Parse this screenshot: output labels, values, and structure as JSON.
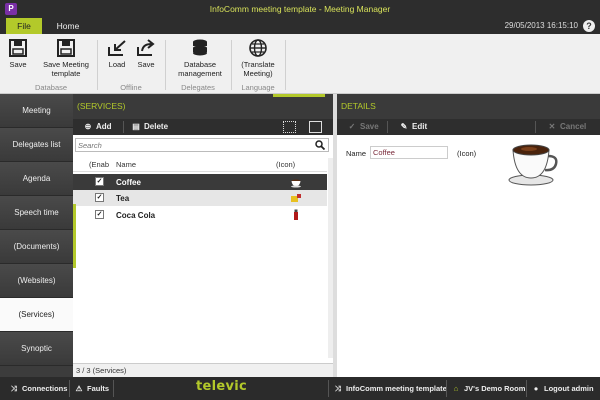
{
  "window": {
    "title": "InfoComm meeting template - Meeting Manager",
    "app_icon": "P"
  },
  "tabs": {
    "file": "File",
    "home": "Home"
  },
  "clock": "29/05/2013 16:15:10",
  "help_symbol": "?",
  "ribbon": {
    "save": "Save",
    "save_meeting_template": "Save Meeting template",
    "load": "Load",
    "save_offline": "Save",
    "database_management": "Database management",
    "translate_meeting": "(Translate Meeting)",
    "groups": {
      "database": "Database",
      "offline": "Offline",
      "delegates": "Delegates",
      "language": "Language"
    }
  },
  "nav": [
    "Meeting",
    "Delegates list",
    "Agenda",
    "Speech time",
    "(Documents)",
    "(Websites)",
    "(Services)",
    "Synoptic"
  ],
  "services": {
    "title": "(SERVICES)",
    "add_label": "Add",
    "delete_label": "Delete",
    "search_placeholder": "Search",
    "columns": {
      "enabled": "(Enab",
      "name": "Name",
      "icon": "(Icon)"
    },
    "rows": [
      {
        "name": "Coffee",
        "enabled": true,
        "icon": "coffee-cup-icon"
      },
      {
        "name": "Tea",
        "enabled": true,
        "icon": "tea-icon"
      },
      {
        "name": "Coca Cola",
        "enabled": true,
        "icon": "cola-bottle-icon"
      }
    ],
    "status": "3  /  3  (Services)"
  },
  "details": {
    "title": "DETAILS",
    "save_label": "Save",
    "edit_label": "Edit",
    "cancel_label": "Cancel",
    "name_label": "Name",
    "name_value": "Coffee",
    "icon_label": "(Icon)"
  },
  "statusbar": {
    "connections": "Connections",
    "faults": "Faults",
    "brand": "televic",
    "meeting": "InfoComm meeting template",
    "room": "JV's  Demo Room",
    "logout": "Logout admin"
  },
  "colors": {
    "accent": "#b3c92a",
    "dark": "#2d2d2d",
    "purple": "#7a2fa6"
  }
}
